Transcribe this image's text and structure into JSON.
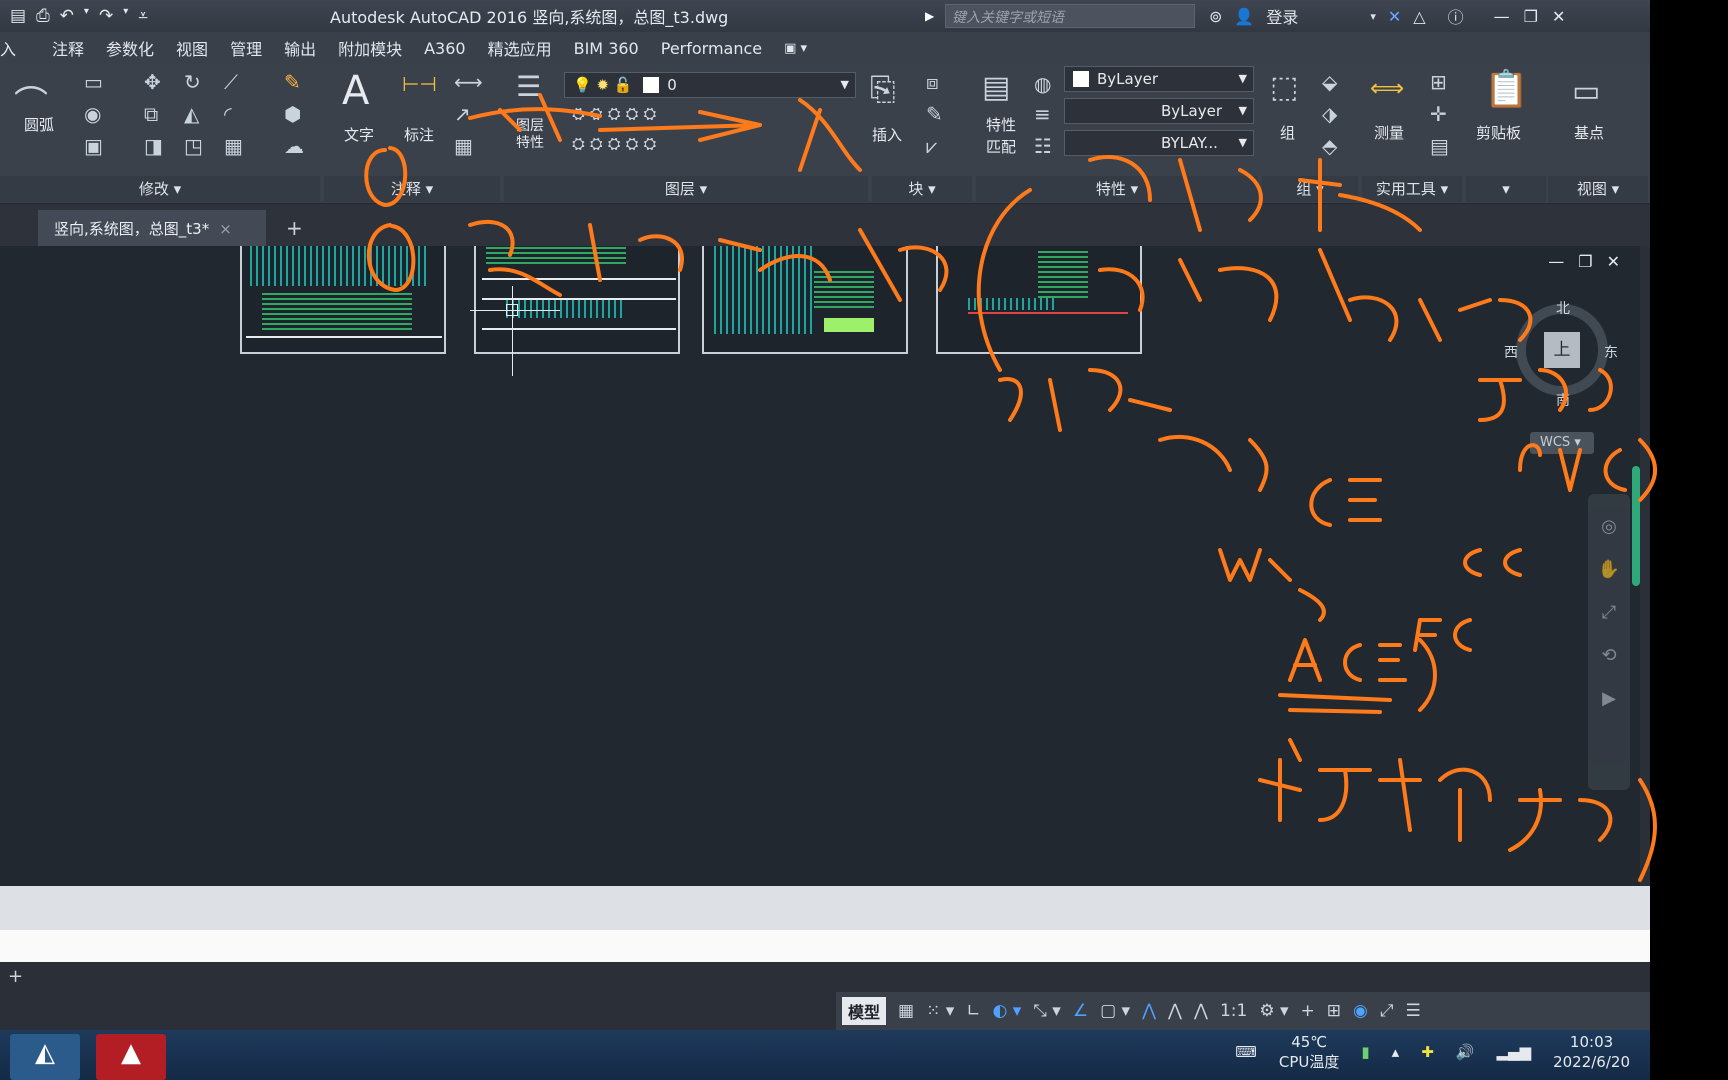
{
  "window": {
    "title": "Autodesk AutoCAD 2016    竖向,系统图，总图_t3.dwg",
    "search_placeholder": "键入关键字或短语",
    "login": "登录"
  },
  "menu": [
    "入",
    "注释",
    "参数化",
    "视图",
    "管理",
    "输出",
    "附加模块",
    "A360",
    "精选应用",
    "BIM 360",
    "Performance"
  ],
  "ribbon": {
    "arc": "圆弧",
    "text": "文字",
    "dimension": "标注",
    "layer_props": "图层\n特性",
    "layer_value": "0",
    "insert": "插入",
    "match_props": "特性\n匹配",
    "color": "ByLayer",
    "linetype": "ByLayer",
    "lineweight": "BYLAY...",
    "group": "组",
    "measure": "测量",
    "clipboard": "剪贴板",
    "base": "基点",
    "panels": {
      "modify": "修改 ▾",
      "annotate": "注释 ▾",
      "layers": "图层 ▾",
      "block": "块 ▾",
      "properties": "特性 ▾",
      "group": "组 ▾",
      "utilities": "实用工具 ▾",
      "view": "视图 ▾"
    }
  },
  "doc_tab": {
    "label": "竖向,系统图，总图_t3*",
    "close": "×",
    "new": "+"
  },
  "viewcube": {
    "face": "上",
    "north": "北",
    "south": "南",
    "east": "东",
    "west": "西",
    "wcs": "WCS ▾"
  },
  "status": {
    "model": "模型",
    "scale": "1:1"
  },
  "taskbar": {
    "temp": "45℃",
    "temp_label": "CPU温度",
    "time": "10:03",
    "date": "2022/6/20"
  },
  "colors": {
    "annotation": "#ff7a1a",
    "canvas": "#212830",
    "ribbon": "#3b414b"
  }
}
